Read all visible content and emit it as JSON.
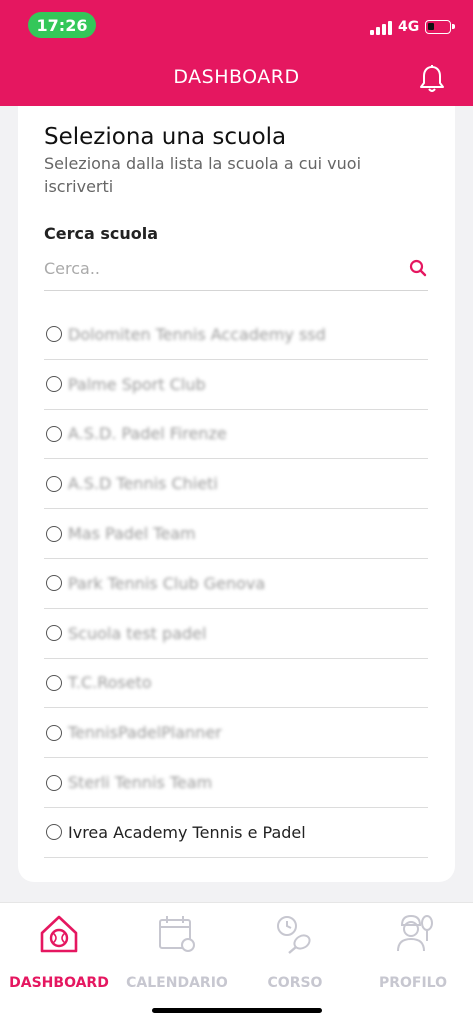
{
  "status_bar": {
    "time": "17:26",
    "network": "4G"
  },
  "header": {
    "title": "DASHBOARD",
    "bell_icon": "bell-icon"
  },
  "card": {
    "title": "Seleziona una scuola",
    "subtitle": "Seleziona dalla lista la scuola a cui vuoi iscriverti",
    "search": {
      "label": "Cerca scuola",
      "placeholder": "Cerca..",
      "value": ""
    },
    "schools": [
      "Dolomiten Tennis Accademy ssd",
      "Palme Sport Club",
      "A.S.D. Padel Firenze",
      "A.S.D Tennis Chieti",
      "Mas Padel Team",
      "Park Tennis Club Genova",
      "Scuola test padel",
      "T.C.Roseto",
      "TennisPadelPlanner",
      "Sterli Tennis Team",
      "Ivrea Academy Tennis e Padel"
    ]
  },
  "bottom_nav": {
    "items": [
      {
        "label": "DASHBOARD",
        "icon": "home-tennis-icon",
        "active": true
      },
      {
        "label": "CALENDARIO",
        "icon": "calendar-icon",
        "active": false
      },
      {
        "label": "CORSO",
        "icon": "course-icon",
        "active": false
      },
      {
        "label": "PROFILO",
        "icon": "profile-icon",
        "active": false
      }
    ]
  },
  "colors": {
    "brand": "#e51760",
    "status_pill": "#34c759",
    "inactive_nav": "#c7c7d0"
  }
}
